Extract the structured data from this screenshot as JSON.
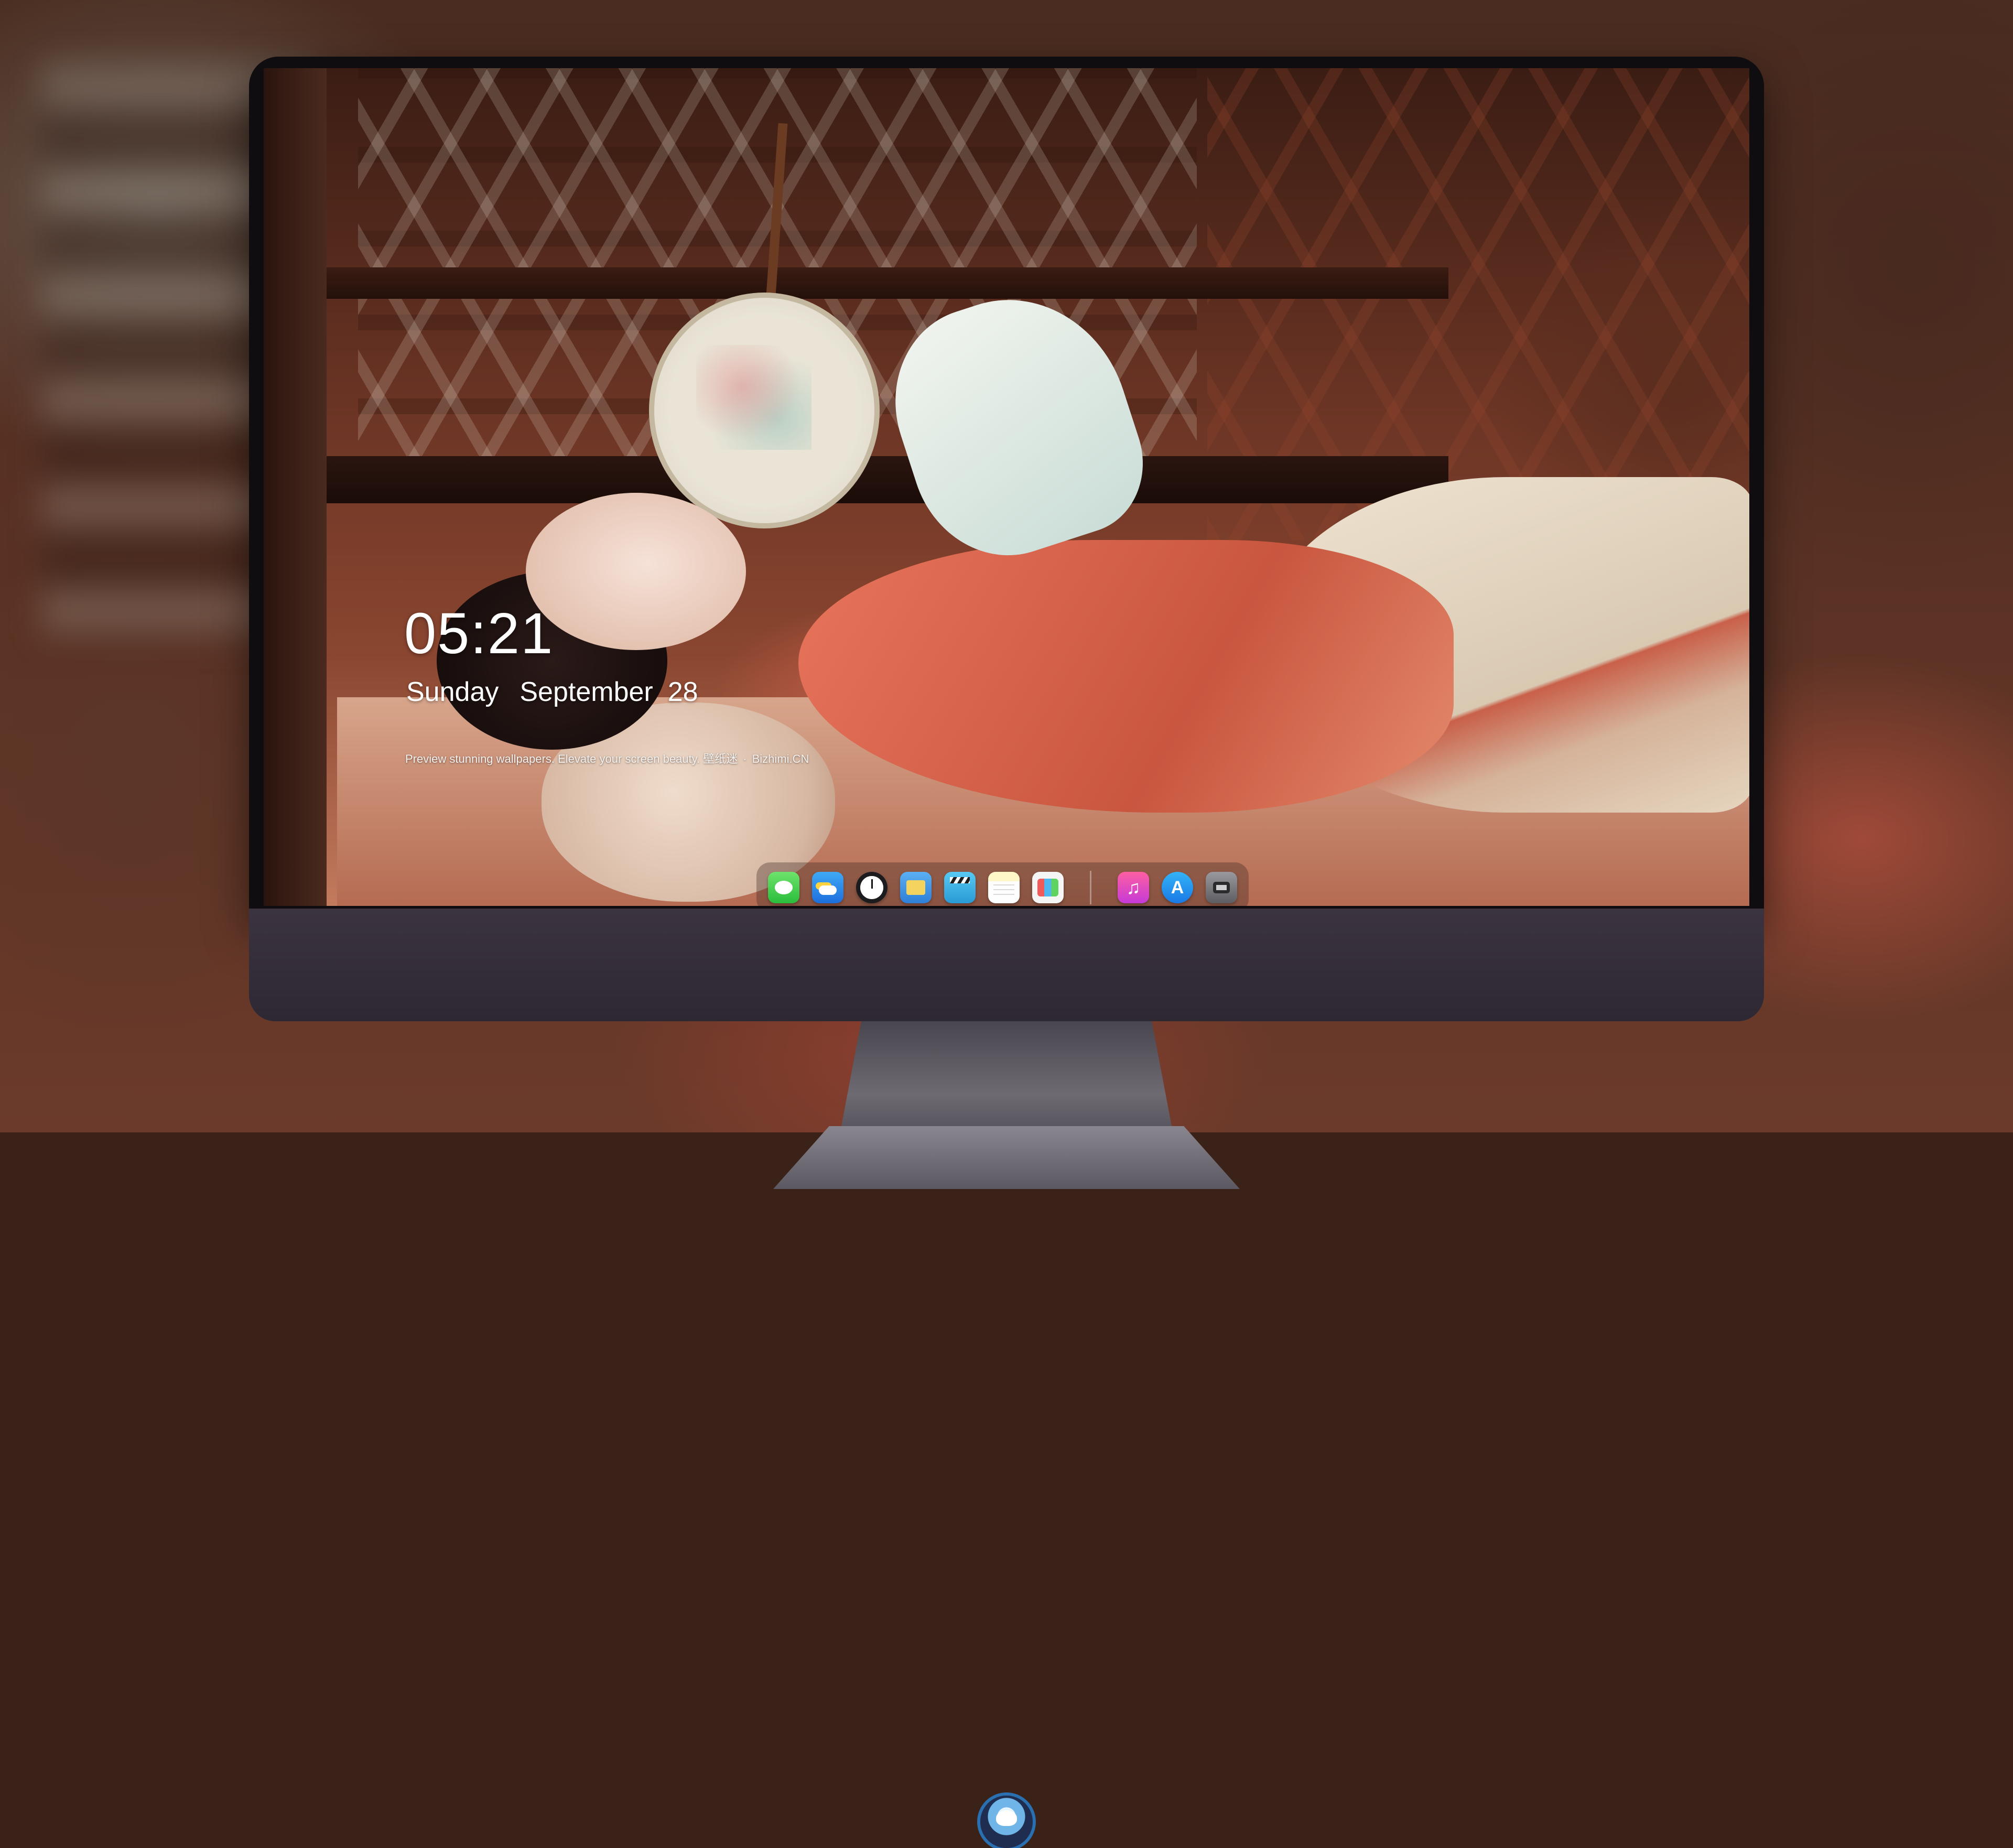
{
  "lockscreen": {
    "time": "05:21",
    "weekday": "Sunday",
    "month": "September",
    "day": "28",
    "tagline": "Preview stunning wallpapers. Elevate your screen beauty.",
    "brand_cn": "壁纸迷",
    "brand_site": "Bizhimi.CN"
  },
  "dock": {
    "apps": [
      {
        "name": "Messages",
        "icon": "messages-icon"
      },
      {
        "name": "Weather",
        "icon": "weather-icon"
      },
      {
        "name": "Clock",
        "icon": "clock-icon"
      },
      {
        "name": "Preview",
        "icon": "preview-icon"
      },
      {
        "name": "Video",
        "icon": "clapperboard-icon"
      },
      {
        "name": "Notes",
        "icon": "notes-icon"
      },
      {
        "name": "Photos",
        "icon": "photos-icon"
      },
      {
        "name": "Music",
        "icon": "music-icon"
      },
      {
        "name": "App Store",
        "icon": "app-store-icon"
      },
      {
        "name": "Camera",
        "icon": "camera-icon"
      }
    ]
  },
  "colors": {
    "bezel": "#0f0d0f",
    "chin": "#3b3440",
    "text": "#ffffff"
  }
}
